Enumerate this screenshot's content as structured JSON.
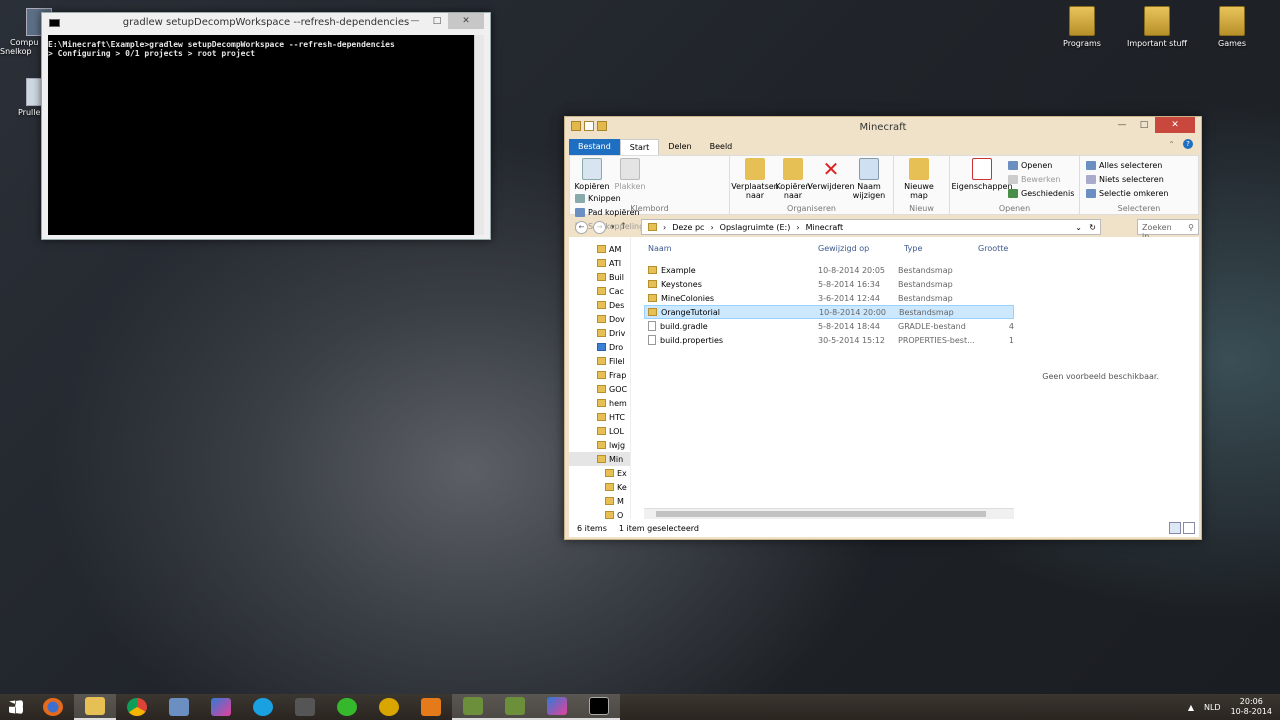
{
  "desktop": {
    "left_icons": [
      {
        "label": "Compu",
        "label2": "Snelkop"
      },
      {
        "label": "Prulle"
      }
    ],
    "right_icons": [
      "Programs",
      "Important stuff",
      "Games"
    ]
  },
  "console": {
    "title": "gradlew  setupDecompWorkspace --refresh-dependencies",
    "lines": [
      "E:\\Minecraft\\Example>gradlew setupDecompWorkspace --refresh-dependencies",
      "> Configuring > 0/1 projects > root project"
    ]
  },
  "explorer": {
    "title": "Minecraft",
    "tabs": [
      "Bestand",
      "Start",
      "Delen",
      "Beeld"
    ],
    "ribbon": {
      "klembord": {
        "label": "Klembord",
        "kopieren": "Kopiëren",
        "plakken": "Plakken",
        "knippen": "Knippen",
        "pad": "Pad kopiëren",
        "snelkoppeling": "Snelkoppeling plakken"
      },
      "organiseren": {
        "label": "Organiseren",
        "verplaatsen": "Verplaatsen naar",
        "kopieren_naar": "Kopiëren naar",
        "verwijderen": "Verwijderen",
        "naam": "Naam wijzigen"
      },
      "nieuw": {
        "label": "Nieuw",
        "nieuwe_map": "Nieuwe map"
      },
      "openen": {
        "label": "Openen",
        "eigenschappen": "Eigenschappen",
        "openen": "Openen",
        "bewerken": "Bewerken",
        "geschiedenis": "Geschiedenis"
      },
      "selecteren": {
        "label": "Selecteren",
        "alles": "Alles selecteren",
        "niets": "Niets selecteren",
        "omkeren": "Selectie omkeren"
      }
    },
    "breadcrumb": [
      "Deze pc",
      "Opslagruimte (E:)",
      "Minecraft"
    ],
    "search_placeholder": "Zoeken in...",
    "tree": [
      "AM",
      "ATI",
      "Buil",
      "Cac",
      "Des",
      "Dov",
      "Driv",
      "Dro",
      "Filel",
      "Frap",
      "GOC",
      "hem",
      "HTC",
      "LOL",
      "lwjg",
      "Min",
      "Ex",
      "Ke",
      "M",
      "O"
    ],
    "columns": [
      "Naam",
      "Gewijzigd op",
      "Type",
      "Grootte"
    ],
    "files": [
      {
        "name": "Example",
        "date": "10-8-2014 20:05",
        "type": "Bestandsmap",
        "size": "",
        "folder": true
      },
      {
        "name": "Keystones",
        "date": "5-8-2014 16:34",
        "type": "Bestandsmap",
        "size": "",
        "folder": true
      },
      {
        "name": "MineColonies",
        "date": "3-6-2014 12:44",
        "type": "Bestandsmap",
        "size": "",
        "folder": true
      },
      {
        "name": "OrangeTutorial",
        "date": "10-8-2014 20:00",
        "type": "Bestandsmap",
        "size": "",
        "folder": true,
        "selected": true
      },
      {
        "name": "build.gradle",
        "date": "5-8-2014 18:44",
        "type": "GRADLE-bestand",
        "size": "4",
        "folder": false
      },
      {
        "name": "build.properties",
        "date": "30-5-2014 15:12",
        "type": "PROPERTIES-best...",
        "size": "1",
        "folder": false
      }
    ],
    "preview_text": "Geen voorbeeld beschikbaar.",
    "status_count": "6 items",
    "status_selected": "1 item geselecteerd"
  },
  "taskbar": {
    "apps": [
      "windows-start",
      "firefox",
      "file-explorer",
      "chrome",
      "visual-app",
      "intellij",
      "skype",
      "media-app",
      "razer",
      "headset-app",
      "orange-app",
      "minecraft-1",
      "minecraft-2",
      "intellij-2",
      "cmd"
    ],
    "language": "NLD",
    "time": "20:06",
    "date": "10-8-2014"
  }
}
